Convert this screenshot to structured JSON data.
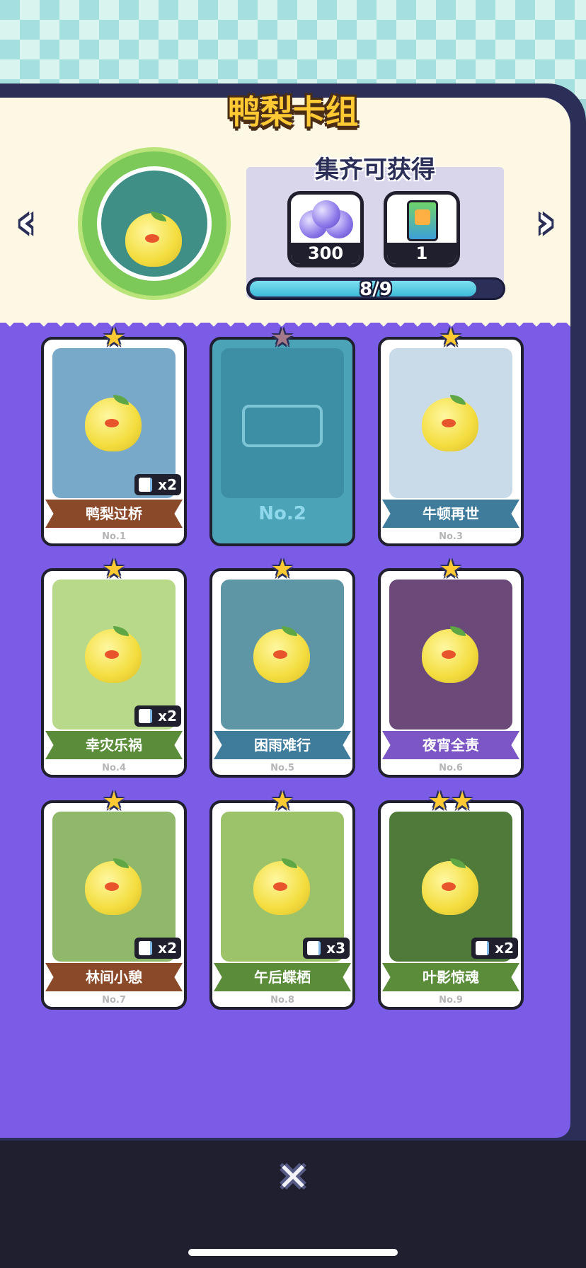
{
  "header": {
    "title": "鸭梨卡组"
  },
  "reward": {
    "title": "集齐可获得",
    "items": [
      {
        "icon": "gem-bundle-icon",
        "quantity": "300"
      },
      {
        "icon": "card-pack-icon",
        "quantity": "1"
      }
    ],
    "progress_text": "8/9",
    "progress_fraction": 0.89
  },
  "colors": {
    "panel": "#7a5ce6",
    "cream": "#fdf8e3",
    "title": "#ffc933",
    "banner_brown": "#8a4a2a",
    "banner_blue": "#3f7c9c",
    "banner_green": "#5a8c3a",
    "banner_purple": "#7b56c4"
  },
  "cards": [
    {
      "name": "鸭梨过桥",
      "no": "No.1",
      "stars": 1,
      "dup": "x2",
      "banner": "#8a4a2a",
      "art": "#78a9c9",
      "locked": false
    },
    {
      "name": "No.2",
      "no": "",
      "stars": 1,
      "dup": "",
      "banner": "#3d8fa5",
      "art": "#3d8fa5",
      "locked": true
    },
    {
      "name": "牛顿再世",
      "no": "No.3",
      "stars": 1,
      "dup": "",
      "banner": "#3f7c9c",
      "art": "#c9dbe8",
      "locked": false
    },
    {
      "name": "幸灾乐祸",
      "no": "No.4",
      "stars": 1,
      "dup": "x2",
      "banner": "#5a8c3a",
      "art": "#b8d98a",
      "locked": false
    },
    {
      "name": "困雨难行",
      "no": "No.5",
      "stars": 1,
      "dup": "",
      "banner": "#3f7c9c",
      "art": "#5f96a6",
      "locked": false
    },
    {
      "name": "夜宵全责",
      "no": "No.6",
      "stars": 1,
      "dup": "",
      "banner": "#7b56c4",
      "art": "#6b4a7a",
      "locked": false
    },
    {
      "name": "林间小憩",
      "no": "No.7",
      "stars": 1,
      "dup": "x2",
      "banner": "#8a4a2a",
      "art": "#8fb86a",
      "locked": false
    },
    {
      "name": "午后蝶栖",
      "no": "No.8",
      "stars": 1,
      "dup": "x3",
      "banner": "#5a8c3a",
      "art": "#9cc26a",
      "locked": false
    },
    {
      "name": "叶影惊魂",
      "no": "No.9",
      "stars": 2,
      "dup": "x2",
      "banner": "#5a8c3a",
      "art": "#4f7a3a",
      "locked": false
    }
  ]
}
